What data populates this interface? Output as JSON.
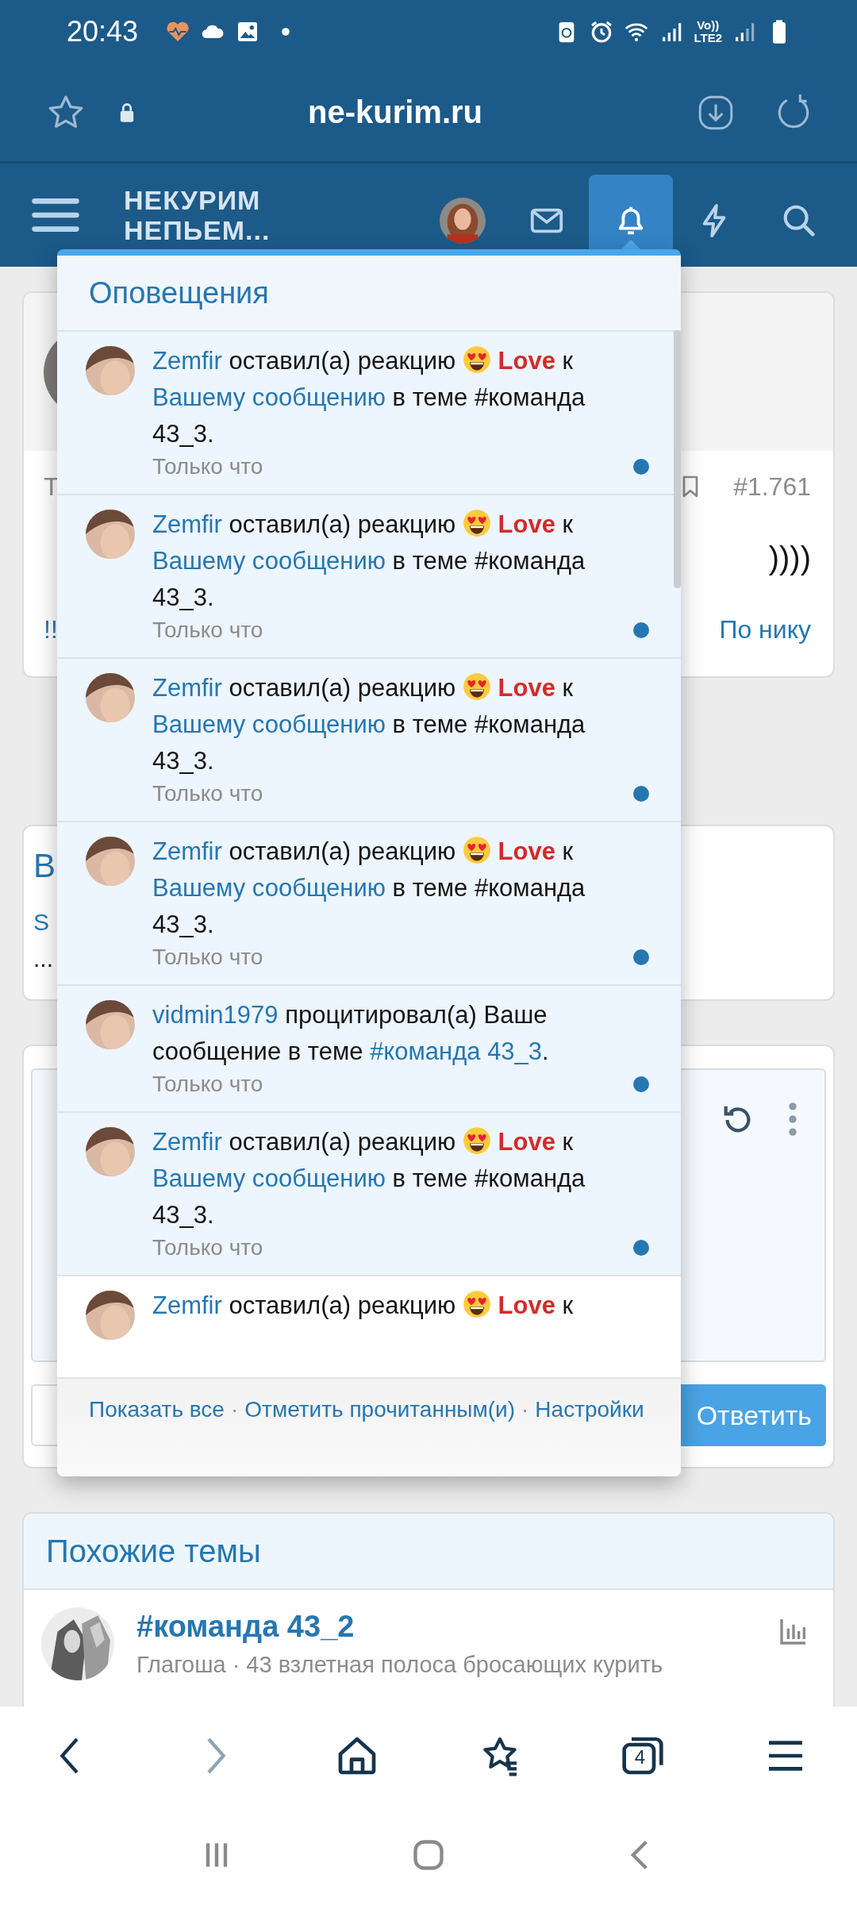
{
  "status_bar": {
    "time": "20:43",
    "network_label": [
      "Vo))",
      "LTE2"
    ]
  },
  "browser": {
    "url": "ne-kurim.ru",
    "bottom_bar": [
      {
        "kind": "back",
        "disabled": false
      },
      {
        "kind": "forward",
        "disabled": true
      },
      {
        "kind": "home",
        "disabled": false
      },
      {
        "kind": "bookmarks",
        "disabled": false
      },
      {
        "kind": "tabs",
        "disabled": false,
        "count": "4"
      },
      {
        "kind": "menu",
        "disabled": false
      }
    ]
  },
  "forum_header": {
    "logo": [
      "НЕКУРИМ",
      "НЕПЬЕМ..."
    ],
    "nav": [
      {
        "kind": "avatar",
        "selected": false
      },
      {
        "kind": "mail",
        "selected": false
      },
      {
        "kind": "bell",
        "selected": true
      },
      {
        "kind": "lightning",
        "selected": false
      },
      {
        "kind": "search",
        "selected": false
      }
    ]
  },
  "background_post": {
    "left_texts": [
      "Т",
      "!!"
    ],
    "post_number": "#1.761",
    "content_tail": "))))",
    "link": "По нику"
  },
  "background_card": {
    "title_start": "В",
    "texts": [
      "S",
      "..."
    ]
  },
  "reply_box": {
    "button": "Ответить"
  },
  "similar_threads": {
    "title": "Похожие темы",
    "items": [
      {
        "title": "#команда 43_2",
        "meta": "Глагоша · 43 взлетная полоса бросающих курить"
      }
    ]
  },
  "notifications": {
    "title": "Оповещения",
    "items": [
      {
        "unread": true,
        "time": "Только что",
        "segments": [
          {
            "kind": "user",
            "text": "Zemfir"
          },
          {
            "kind": "plain",
            "text": "оставил(а) реакцию"
          },
          {
            "kind": "emoji"
          },
          {
            "kind": "reaction",
            "text": "Love"
          },
          {
            "kind": "plain",
            "text": "к"
          },
          {
            "kind": "link",
            "text": "Вашему сообщению"
          },
          {
            "kind": "plain",
            "text": "в теме #команда 43_3."
          }
        ]
      },
      {
        "unread": true,
        "time": "Только что",
        "segments": [
          {
            "kind": "user",
            "text": "Zemfir"
          },
          {
            "kind": "plain",
            "text": "оставил(а) реакцию"
          },
          {
            "kind": "emoji"
          },
          {
            "kind": "reaction",
            "text": "Love"
          },
          {
            "kind": "plain",
            "text": "к"
          },
          {
            "kind": "link",
            "text": "Вашему сообщению"
          },
          {
            "kind": "plain",
            "text": "в теме #команда 43_3."
          }
        ]
      },
      {
        "unread": true,
        "time": "Только что",
        "segments": [
          {
            "kind": "user",
            "text": "Zemfir"
          },
          {
            "kind": "plain",
            "text": "оставил(а) реакцию"
          },
          {
            "kind": "emoji"
          },
          {
            "kind": "reaction",
            "text": "Love"
          },
          {
            "kind": "plain",
            "text": "к"
          },
          {
            "kind": "link",
            "text": "Вашему сообщению"
          },
          {
            "kind": "plain",
            "text": "в теме #команда 43_3."
          }
        ]
      },
      {
        "unread": true,
        "time": "Только что",
        "segments": [
          {
            "kind": "user",
            "text": "Zemfir"
          },
          {
            "kind": "plain",
            "text": "оставил(а) реакцию"
          },
          {
            "kind": "emoji"
          },
          {
            "kind": "reaction",
            "text": "Love"
          },
          {
            "kind": "plain",
            "text": "к"
          },
          {
            "kind": "link",
            "text": "Вашему сообщению"
          },
          {
            "kind": "plain",
            "text": "в теме #команда 43_3."
          }
        ]
      },
      {
        "unread": true,
        "time": "Только что",
        "segments": [
          {
            "kind": "user",
            "text": "vidmin1979"
          },
          {
            "kind": "plain",
            "text": "процитировал(а) Ваше сообщение в теме"
          },
          {
            "kind": "link",
            "text": "#команда 43_3"
          },
          {
            "kind": "punct",
            "text": "."
          }
        ]
      },
      {
        "unread": true,
        "time": "Только что",
        "segments": [
          {
            "kind": "user",
            "text": "Zemfir"
          },
          {
            "kind": "plain",
            "text": "оставил(а) реакцию"
          },
          {
            "kind": "emoji"
          },
          {
            "kind": "reaction",
            "text": "Love"
          },
          {
            "kind": "plain",
            "text": "к"
          },
          {
            "kind": "link",
            "text": "Вашему сообщению"
          },
          {
            "kind": "plain",
            "text": "в теме #команда 43_3."
          }
        ]
      },
      {
        "unread": false,
        "segments": [
          {
            "kind": "user",
            "text": "Zemfir"
          },
          {
            "kind": "plain",
            "text": "оставил(а) реакцию"
          },
          {
            "kind": "emoji"
          },
          {
            "kind": "reaction",
            "text": "Love"
          },
          {
            "kind": "plain",
            "text": "к"
          }
        ]
      }
    ],
    "footer": {
      "links": [
        "Показать все",
        "Отметить прочитанным(и)",
        "Настройки"
      ],
      "separator": "·"
    }
  }
}
